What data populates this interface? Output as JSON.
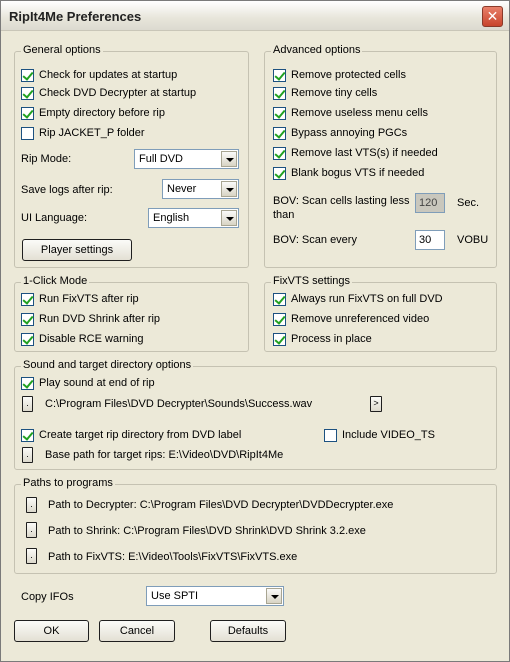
{
  "window": {
    "title": "RipIt4Me Preferences",
    "close_label": "✕"
  },
  "general": {
    "title": "General options",
    "checks": [
      {
        "label": "Check for updates at startup",
        "checked": true
      },
      {
        "label": "Check DVD Decrypter at startup",
        "checked": true
      },
      {
        "label": "Empty directory before rip",
        "checked": true
      },
      {
        "label": "Rip JACKET_P folder",
        "checked": false
      }
    ],
    "rip_mode_label": "Rip Mode:",
    "rip_mode_value": "Full DVD",
    "save_logs_label": "Save logs after rip:",
    "save_logs_value": "Never",
    "ui_language_label": "UI Language:",
    "ui_language_value": "English",
    "player_settings_label": "Player settings"
  },
  "advanced": {
    "title": "Advanced options",
    "checks": [
      {
        "label": "Remove protected cells",
        "checked": true
      },
      {
        "label": "Remove tiny cells",
        "checked": true
      },
      {
        "label": "Remove useless menu cells",
        "checked": true
      },
      {
        "label": "Bypass annoying PGCs",
        "checked": true
      },
      {
        "label": "Remove last VTS(s) if needed",
        "checked": true
      },
      {
        "label": "Blank bogus VTS if needed",
        "checked": true
      }
    ],
    "bov_cells_label_1": "BOV: Scan cells lasting less",
    "bov_cells_label_2": "than",
    "bov_cells_value": "120",
    "bov_cells_unit": "Sec.",
    "bov_scan_label": "BOV: Scan every",
    "bov_scan_value": "30",
    "bov_scan_unit": "VOBU"
  },
  "oneclick": {
    "title": "1-Click Mode",
    "checks": [
      {
        "label": "Run FixVTS after rip",
        "checked": true
      },
      {
        "label": "Run DVD Shrink after rip",
        "checked": true
      },
      {
        "label": "Disable RCE warning",
        "checked": true
      }
    ]
  },
  "fixvts": {
    "title": "FixVTS settings",
    "checks": [
      {
        "label": "Always run FixVTS on full DVD",
        "checked": true
      },
      {
        "label": "Remove unreferenced video",
        "checked": true
      },
      {
        "label": "Process in place",
        "checked": true
      }
    ]
  },
  "sound": {
    "title": "Sound and target directory options",
    "play_sound_label": "Play sound at end of rip",
    "play_sound_checked": true,
    "browse_label": ".",
    "sound_path": "C:\\Program Files\\DVD Decrypter\\Sounds\\Success.wav",
    "play_button_label": ">",
    "create_dir_label": "Create target rip directory from DVD label",
    "create_dir_checked": true,
    "include_video_ts_label": "Include VIDEO_TS",
    "include_video_ts_checked": false,
    "base_path_label": "Base path for target rips: E:\\Video\\DVD\\RipIt4Me"
  },
  "paths": {
    "title": "Paths to programs",
    "items": [
      {
        "browse_label": ".",
        "text": "Path to Decrypter: C:\\Program Files\\DVD Decrypter\\DVDDecrypter.exe"
      },
      {
        "browse_label": ".",
        "text": "Path to Shrink: C:\\Program Files\\DVD Shrink\\DVD Shrink 3.2.exe"
      },
      {
        "browse_label": ".",
        "text": "Path to FixVTS: E:\\Video\\Tools\\FixVTS\\FixVTS.exe"
      }
    ]
  },
  "copy_ifos": {
    "label": "Copy IFOs",
    "value": "Use SPTI"
  },
  "buttons": {
    "ok": "OK",
    "cancel": "Cancel",
    "defaults": "Defaults"
  }
}
